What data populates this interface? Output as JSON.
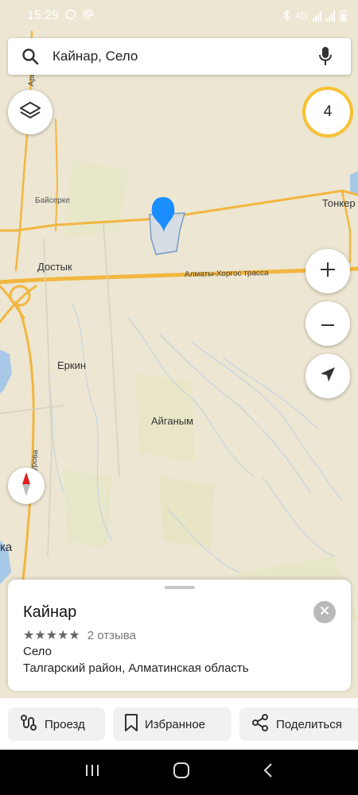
{
  "status_bar": {
    "time": "15:29",
    "network": "4G"
  },
  "search": {
    "query": "Кайнар, Село"
  },
  "traffic_badge": {
    "value": "4"
  },
  "map": {
    "places": [
      {
        "name": "Байсерке",
        "id": "baiserke"
      },
      {
        "name": "Достык",
        "id": "dostyk"
      },
      {
        "name": "Еркин",
        "id": "erkin"
      },
      {
        "name": "Айганым",
        "id": "aiganym"
      },
      {
        "name": "Тонкер",
        "id": "tonker"
      },
      {
        "name": "ка",
        "id": "edge-left"
      }
    ],
    "roads": [
      {
        "name": "Алматы-Хоргос трасса",
        "id": "highway"
      },
      {
        "name": "урова",
        "id": "left-road"
      },
      {
        "name": "Ари",
        "id": "top-left-road"
      }
    ]
  },
  "place_card": {
    "title": "Кайнар",
    "stars": "★★★★★",
    "reviews": "2 отзыва",
    "type": "Село",
    "address": "Талгарский район, Алматинская область"
  },
  "actions": {
    "route": "Проезд",
    "favorite": "Избранное",
    "share": "Поделиться"
  },
  "colors": {
    "accent": "#1a8dff",
    "road": "#f2b640",
    "water": "#a8c8e8",
    "map_bg": "#ece6d2"
  }
}
